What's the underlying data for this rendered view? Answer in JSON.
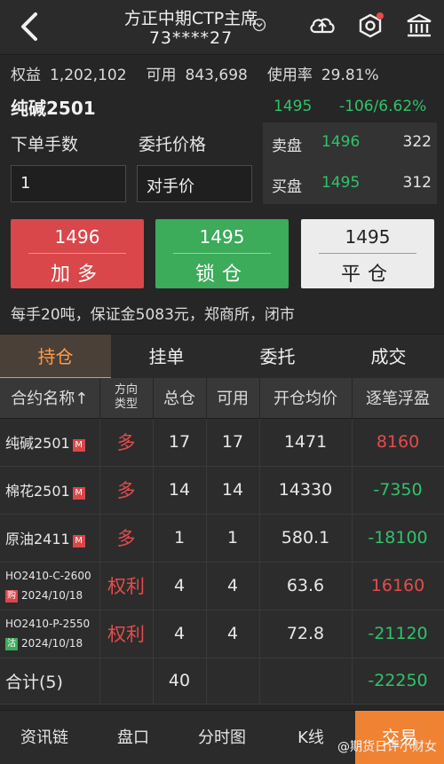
{
  "header": {
    "title": "方正中期CTP主席",
    "account": "73****27"
  },
  "account": {
    "equity_label": "权益",
    "equity_value": "1,202,102",
    "available_label": "可用",
    "available_value": "843,698",
    "usage_label": "使用率",
    "usage_value": "29.81%"
  },
  "instrument": {
    "symbol": "纯碱2501",
    "last_price": "1495",
    "change": "-106/6.62%"
  },
  "order": {
    "qty_label": "下单手数",
    "price_label": "委托价格",
    "qty_value": "1",
    "price_value": "对手价"
  },
  "book": {
    "ask_label": "卖盘",
    "ask_price": "1496",
    "ask_volume": "322",
    "bid_label": "买盘",
    "bid_price": "1495",
    "bid_volume": "312"
  },
  "buttons": [
    {
      "price": "1496",
      "label": "加多"
    },
    {
      "price": "1495",
      "label": "锁仓"
    },
    {
      "price": "1495",
      "label": "平仓"
    }
  ],
  "info_line": "每手20吨，保证金5083元，郑商所，闭市",
  "tabs": [
    "持仓",
    "挂单",
    "委托",
    "成交"
  ],
  "table": {
    "headers": [
      "合约名称↑",
      "方向",
      "类型",
      "总仓",
      "可用",
      "开仓均价",
      "逐笔浮盈"
    ],
    "rows": [
      {
        "name": "纯碱2501",
        "badge": "M",
        "dir": "多",
        "total": "17",
        "avail": "17",
        "avg": "1471",
        "pnl": "8160"
      },
      {
        "name": "棉花2501",
        "badge": "M",
        "dir": "多",
        "total": "14",
        "avail": "14",
        "avg": "14330",
        "pnl": "-7350"
      },
      {
        "name": "原油2411",
        "badge": "M",
        "dir": "多",
        "total": "1",
        "avail": "1",
        "avg": "580.1",
        "pnl": "-18100"
      },
      {
        "name": "HO2410-C-2600",
        "tag": "购",
        "date": "2024/10/18",
        "dir": "权利",
        "total": "4",
        "avail": "4",
        "avg": "63.6",
        "pnl": "16160"
      },
      {
        "name": "HO2410-P-2550",
        "tag": "沽",
        "date": "2024/10/18",
        "dir": "权利",
        "total": "4",
        "avail": "4",
        "avg": "72.8",
        "pnl": "-21120"
      }
    ],
    "total": {
      "label": "合计(5)",
      "total": "40",
      "pnl": "-22250"
    }
  },
  "bottom_nav": [
    "资讯链",
    "盘口",
    "分时图",
    "K线",
    "交易"
  ],
  "watermark": "@期货日评小财女",
  "colors": {
    "up": "#e54b4b",
    "down": "#2fc36a",
    "accent": "#f08333"
  }
}
